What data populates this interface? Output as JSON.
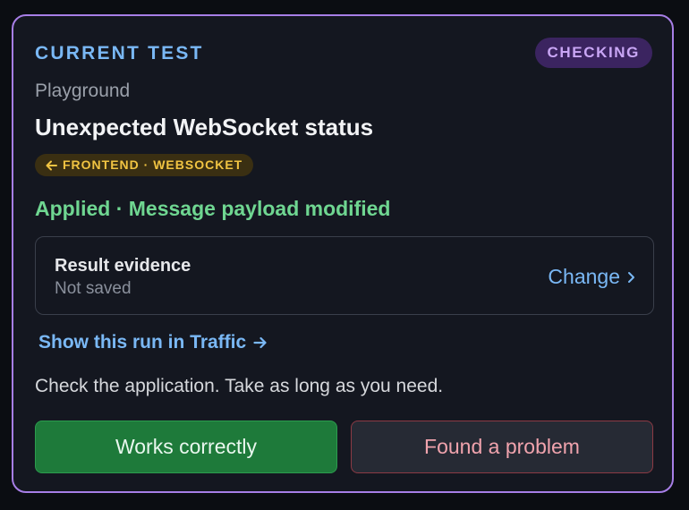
{
  "header": {
    "label": "CURRENT TEST",
    "status_badge": "CHECKING"
  },
  "test": {
    "category": "Playground",
    "title": "Unexpected WebSocket status",
    "direction_badge": "FRONTEND · WEBSOCKET",
    "direction_icon": "arrow-left-icon"
  },
  "applied": {
    "text": "Applied · Message payload modified"
  },
  "evidence": {
    "title": "Result evidence",
    "status": "Not saved",
    "change_label": "Change",
    "change_icon": "chevron-right-icon"
  },
  "traffic_link": {
    "label": "Show this run in Traffic",
    "icon": "arrow-right-icon"
  },
  "instruction": "Check the application. Take as long as you need.",
  "actions": {
    "works_label": "Works correctly",
    "problem_label": "Found a problem"
  },
  "colors": {
    "card_border": "#a77ee6",
    "accent_blue": "#7ab8f5",
    "success_green": "#6fd691",
    "warning_yellow": "#f1c442",
    "danger_pink": "#f0a3ad"
  }
}
